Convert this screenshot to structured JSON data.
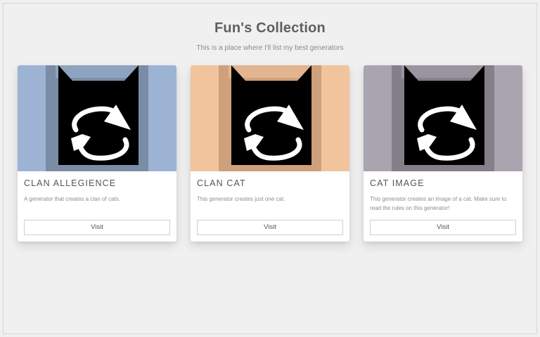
{
  "page": {
    "title": "Fun's Collection",
    "subtitle": "This is a place where I'll list my best generators"
  },
  "cards": [
    {
      "title": "CLAN ALLEGIENCE",
      "description": "A generator that creates a clan of cats.",
      "button_label": "Visit",
      "icon": "cat-refresh-icon",
      "colors": {
        "background": "#9cb3d3",
        "frame": "#7b8ca6",
        "ears": "#8ea3bf",
        "cat": "#000000",
        "arrows": "#ffffff"
      }
    },
    {
      "title": "CLAN CAT",
      "description": "This generator creates just one cat.",
      "button_label": "Visit",
      "icon": "cat-refresh-icon",
      "colors": {
        "background": "#f1c49d",
        "frame": "#cea07c",
        "ears": "#e2b48f",
        "cat": "#000000",
        "arrows": "#ffffff"
      }
    },
    {
      "title": "CAT IMAGE",
      "description": "This generator creates an image of a cat. Make sure to read the rules on this generator!",
      "button_label": "Visit",
      "icon": "cat-refresh-icon",
      "colors": {
        "background": "#a9a4b0",
        "frame": "#857f89",
        "ears": "#9a93a0",
        "cat": "#000000",
        "arrows": "#ffffff"
      }
    }
  ]
}
